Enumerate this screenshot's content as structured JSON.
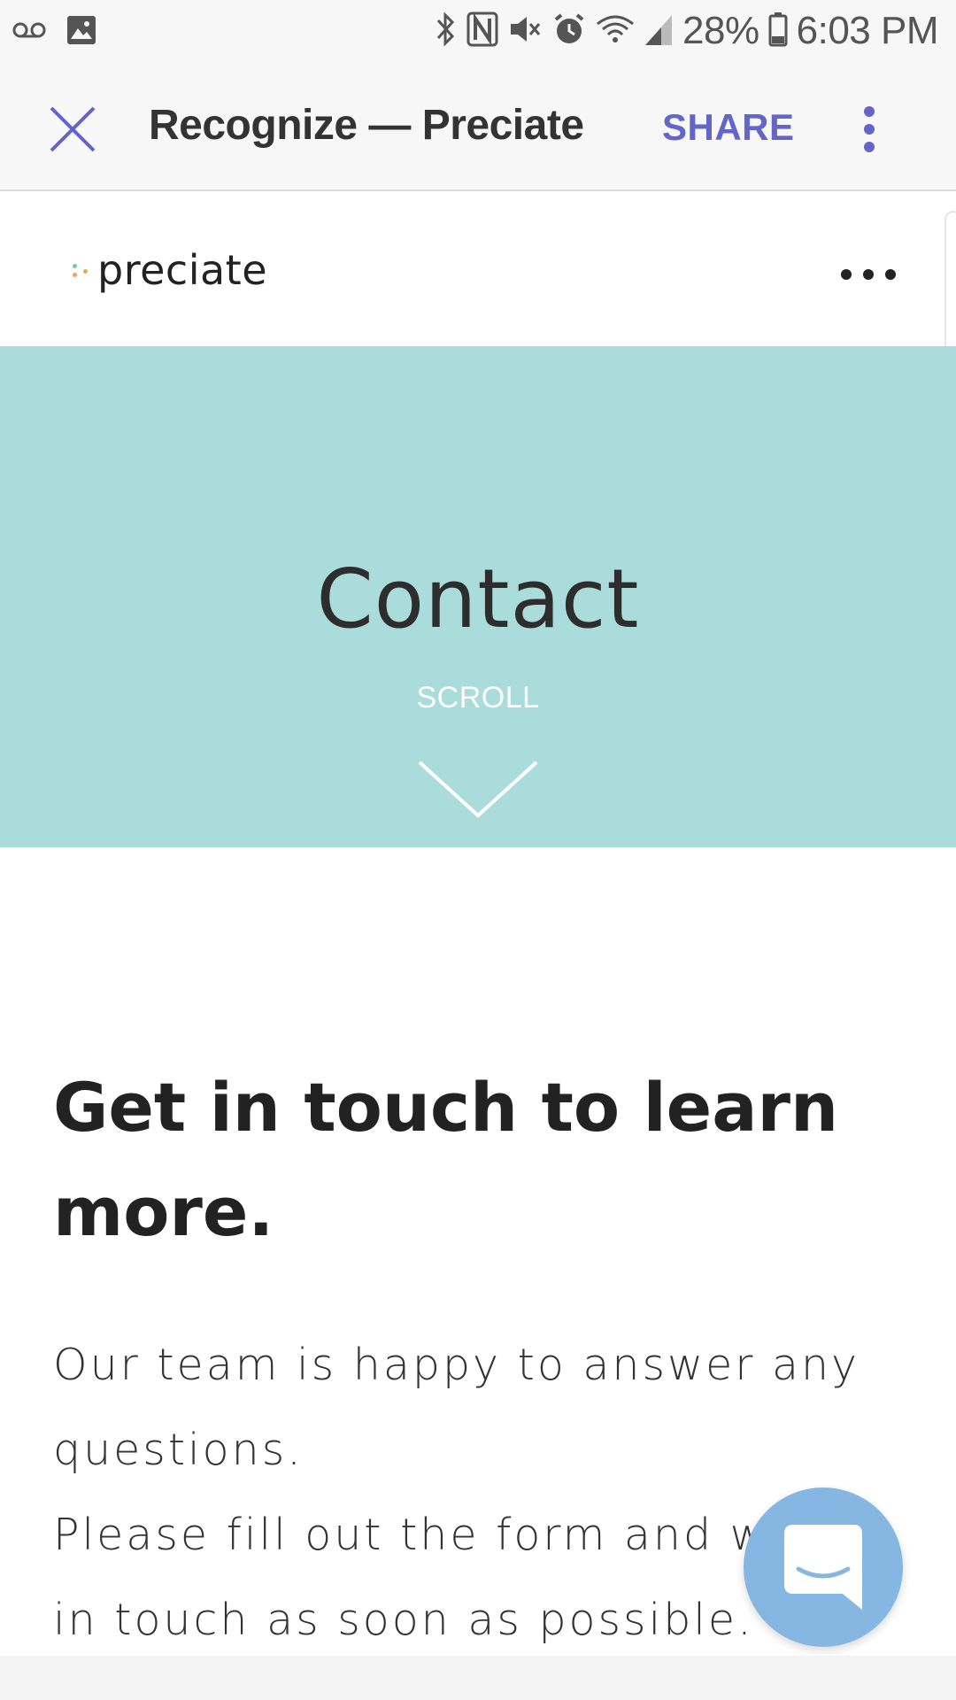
{
  "status_bar": {
    "battery": "28%",
    "time": "6:03 PM",
    "icons": [
      "voicemail-icon",
      "image-icon",
      "bluetooth-icon",
      "nfc-icon",
      "mute-icon",
      "alarm-icon",
      "wifi-icon",
      "signal-icon",
      "battery-icon"
    ]
  },
  "toolbar": {
    "title": "Recognize — Preciate",
    "share_label": "SHARE",
    "accent_color": "#6366c9"
  },
  "site": {
    "logo_text": "preciate",
    "hero_bg": "#aadcdb"
  },
  "hero": {
    "title": "Contact",
    "scroll_label": "SCROLL"
  },
  "content": {
    "heading_line1": "Get in touch to learn",
    "heading_line2": "more.",
    "para_line1": "Our team is happy to answer any",
    "para_line2": "questions.",
    "para_line3": "Please fill out the form and we",
    "para_line4": "in touch as soon as possible."
  }
}
